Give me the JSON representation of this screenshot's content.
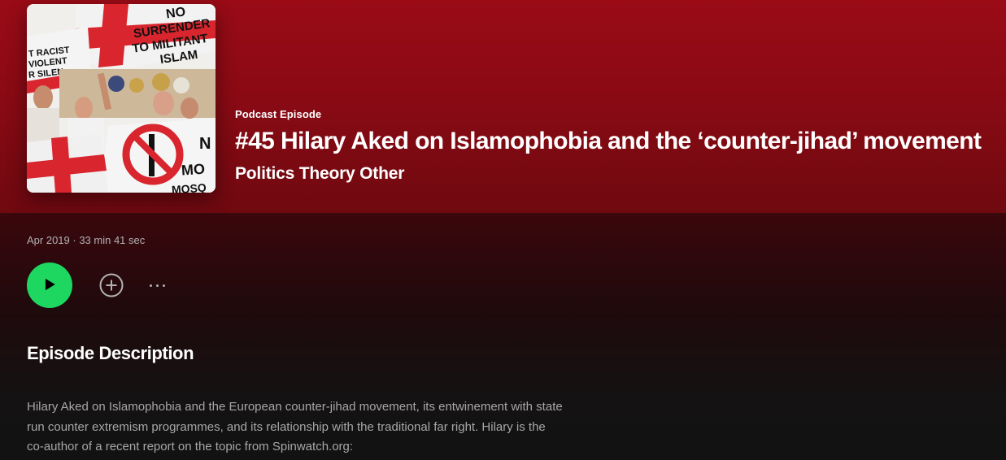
{
  "episode": {
    "type_label": "Podcast Episode",
    "title": "#45 Hilary Aked on Islamophobia and the ‘counter-jihad’ movement",
    "show_name": "Politics Theory Other",
    "meta": "Apr 2019 · 33 min 41 sec",
    "cover_banner_texts": {
      "line1": "NO",
      "line2": "SURRENDER",
      "line3": "TO MILITANT",
      "line4": "ISLAM",
      "left1": "T RACIST",
      "left2": "VIOLENT",
      "left3": "R SILEN",
      "right1": "N",
      "right2": "MO",
      "right3": "MOSQ"
    }
  },
  "actions": {
    "play": "play-icon",
    "add": "add-circle-icon",
    "more": "more-options-icon"
  },
  "description": {
    "heading": "Episode Description",
    "text": "Hilary Aked on Islamophobia and the European counter-jihad movement, its entwinement with state run counter extremism programmes, and its relationship with the traditional far right. Hilary is the co-author of a recent report on the topic from Spinwatch.org:"
  },
  "colors": {
    "hero_accent": "#9a0b16",
    "play_green": "#1ed760",
    "text_primary": "#ffffff",
    "text_secondary": "#b3b3b3"
  }
}
